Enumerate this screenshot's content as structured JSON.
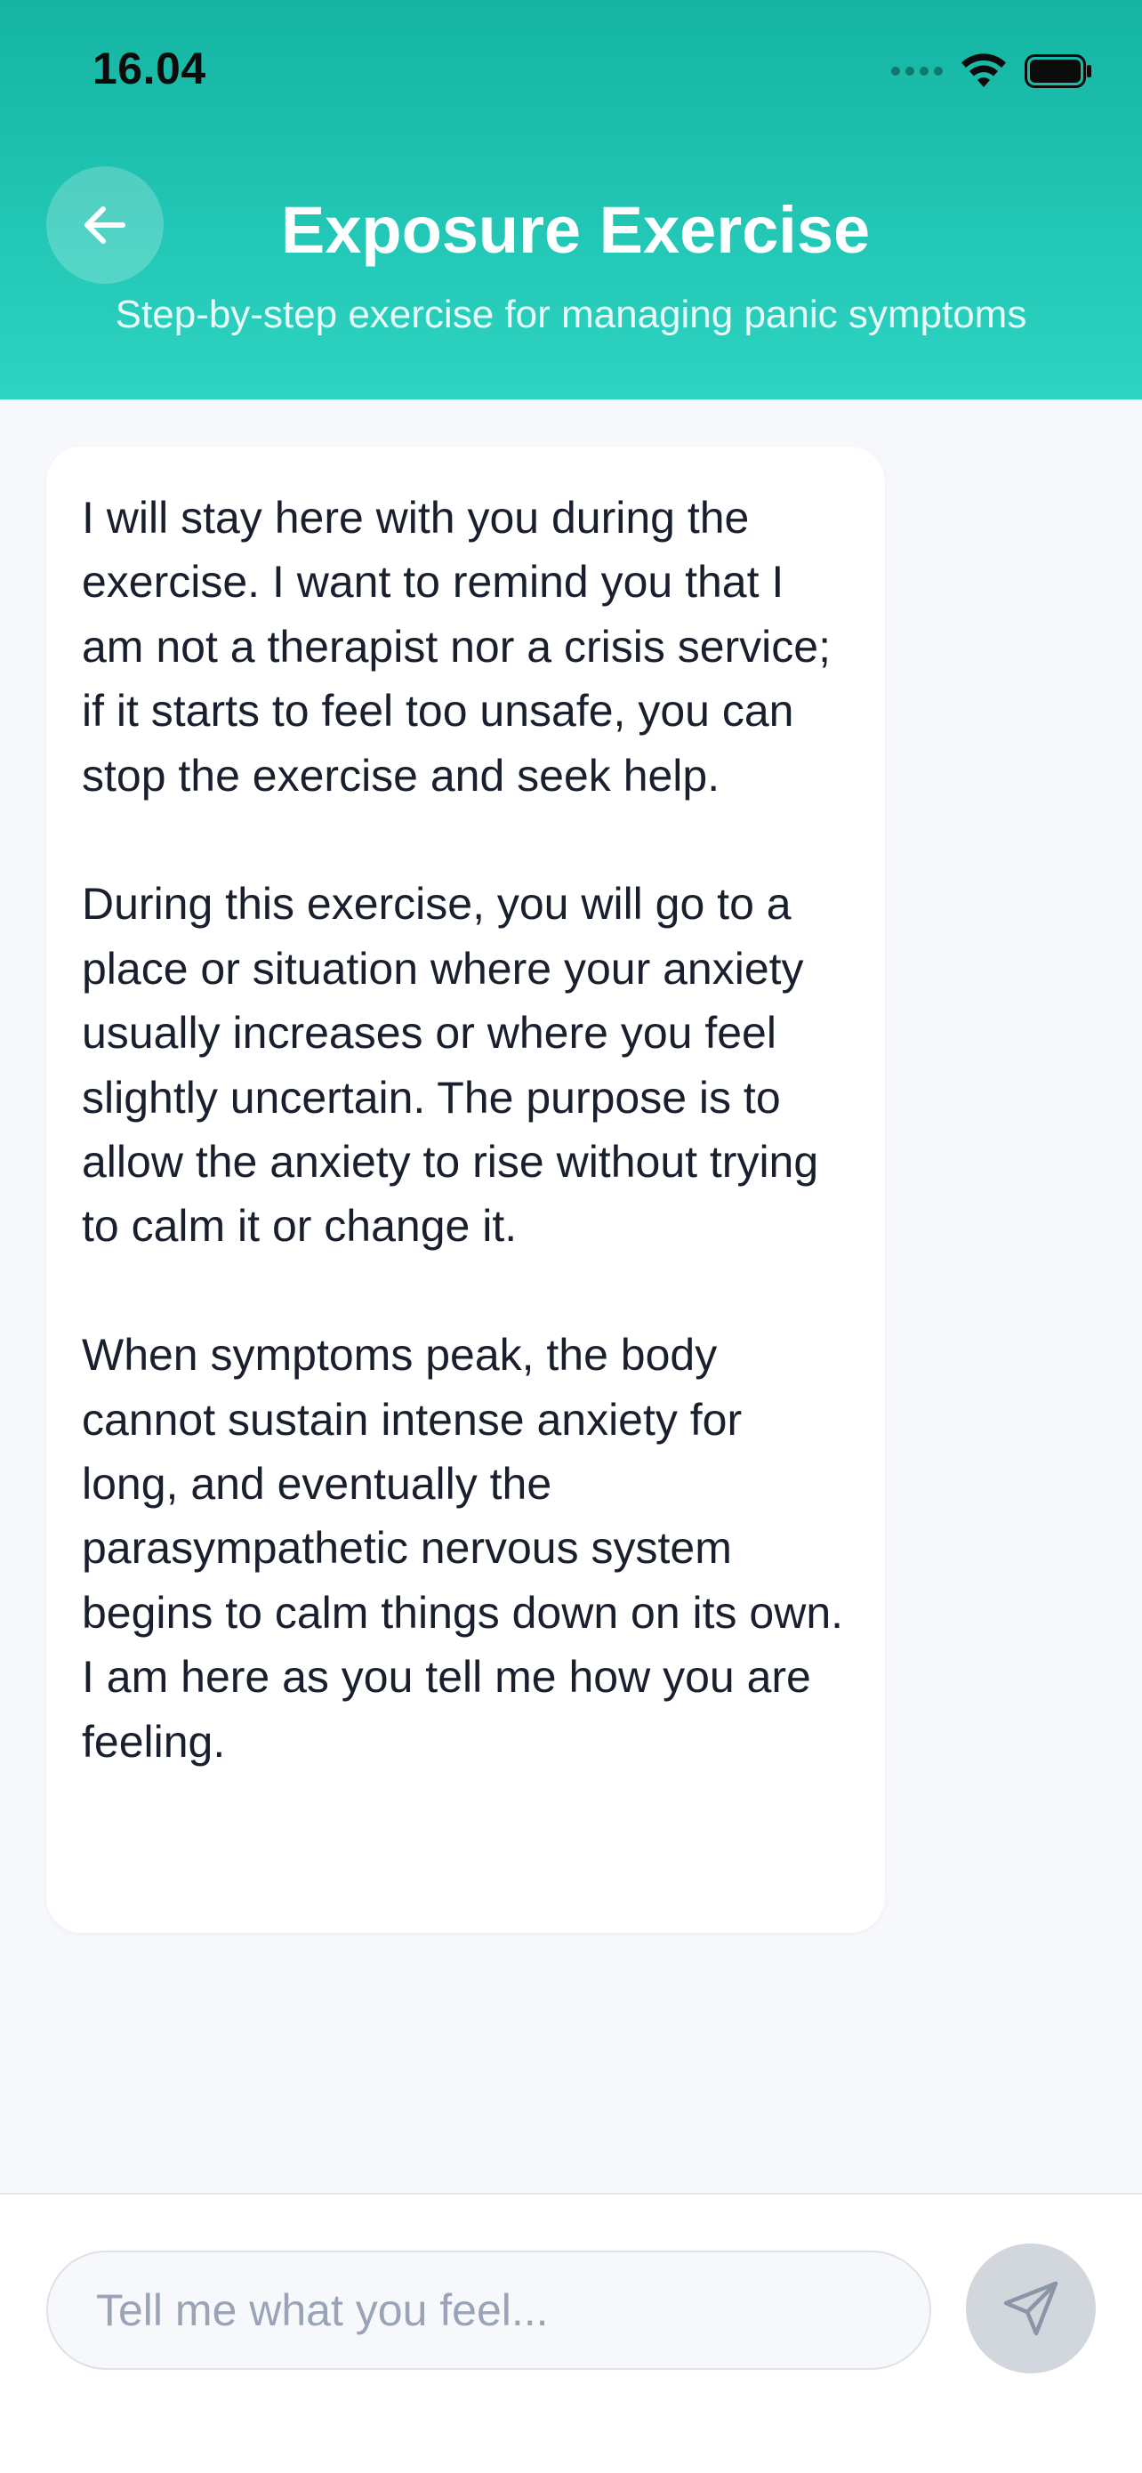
{
  "status_bar": {
    "time": "16.04",
    "icons": [
      "cellular-dots-icon",
      "wifi-icon",
      "battery-icon"
    ]
  },
  "header": {
    "back_icon": "arrow-left-icon",
    "title": "Exposure Exercise",
    "subtitle": "Step-by-step exercise for managing panic symptoms",
    "gradient_colors": [
      "#14b4a1",
      "#2ed3c1"
    ]
  },
  "chat": {
    "messages": [
      {
        "sender": "assistant",
        "paragraphs": [
          "I will stay here with you during the exercise. I want to remind you that I am not a therapist nor a crisis service; if it starts to feel too unsafe, you can stop the exercise and seek help.",
          "During this exercise, you will go to a place or situation where your anxiety usually increases or where you feel slightly uncertain. The purpose is to allow the anxiety to rise without trying to calm it or change it.",
          "When symptoms peak, the body cannot sustain intense anxiety for long, and eventually the parasympathetic nervous system begins to calm things down on its own. I am here as you tell me how you are feeling."
        ]
      }
    ]
  },
  "composer": {
    "input_value": "",
    "placeholder": "Tell me what you feel...",
    "send_icon": "send-icon",
    "send_button_color": "#d2d6dd"
  }
}
